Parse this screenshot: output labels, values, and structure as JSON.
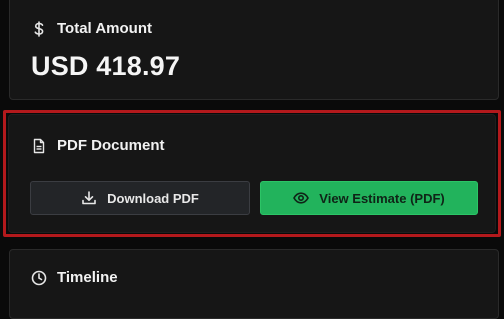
{
  "total": {
    "icon": "dollar-icon",
    "title": "Total Amount",
    "amount": "USD 418.97"
  },
  "pdf": {
    "icon": "document-icon",
    "title": "PDF Document",
    "download_label": "Download PDF",
    "download_icon": "download-icon",
    "view_label": "View Estimate (PDF)",
    "view_icon": "eye-icon"
  },
  "timeline": {
    "icon": "clock-icon",
    "title": "Timeline"
  },
  "colors": {
    "background": "#0a0a0a",
    "card": "#161616",
    "highlight_outline": "#b3191c",
    "primary_green": "#22b35c",
    "secondary_button": "#232528"
  }
}
